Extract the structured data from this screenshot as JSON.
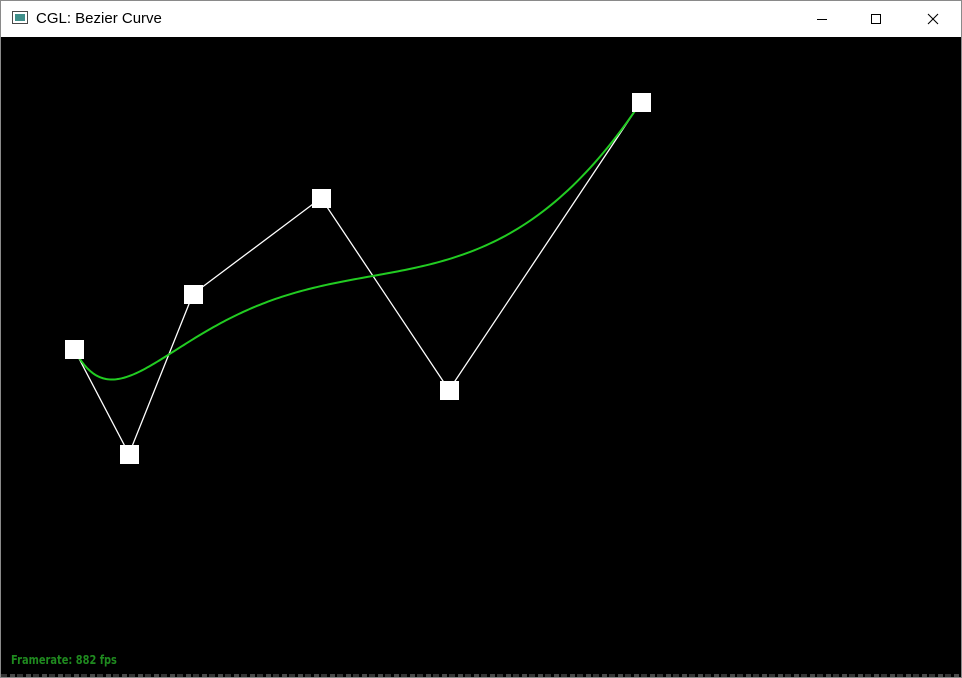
{
  "window": {
    "title": "CGL: Bezier Curve",
    "icon": "app-window-icon"
  },
  "controls": {
    "minimize": "minimize-icon",
    "maximize": "maximize-icon",
    "close": "close-icon"
  },
  "scene": {
    "background_color": "#000000",
    "control_polygon_color": "#ffffff",
    "curve_color": "#22cc22",
    "control_point_color": "#ffffff",
    "control_point_count": 6
  },
  "status": {
    "framerate_label": "Framerate:",
    "framerate_value": "882 fps"
  }
}
